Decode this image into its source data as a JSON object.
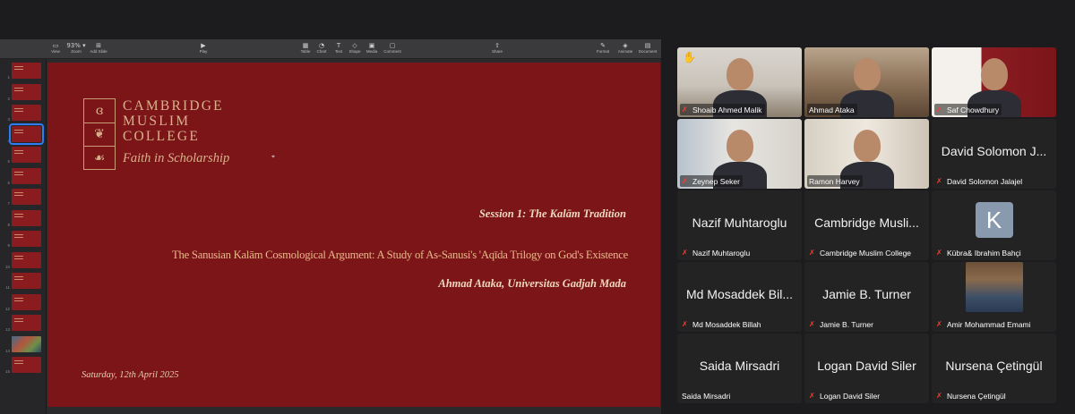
{
  "keynote": {
    "toolbar": [
      {
        "icon": "view-icon",
        "glyph": "▭",
        "label": "View"
      },
      {
        "icon": "zoom-icon",
        "glyph": "93% ▾",
        "label": "Zoom"
      },
      {
        "icon": "add-slide-icon",
        "glyph": "⊞",
        "label": "Add Slide"
      },
      {
        "icon": "play-icon",
        "glyph": "▶",
        "label": "Play"
      },
      {
        "icon": "table-icon",
        "glyph": "▦",
        "label": "Table"
      },
      {
        "icon": "chart-icon",
        "glyph": "◔",
        "label": "Chart"
      },
      {
        "icon": "text-icon",
        "glyph": "T",
        "label": "Text"
      },
      {
        "icon": "shape-icon",
        "glyph": "◇",
        "label": "Shape"
      },
      {
        "icon": "media-icon",
        "glyph": "▣",
        "label": "Media"
      },
      {
        "icon": "comment-icon",
        "glyph": "▢",
        "label": "Comment"
      },
      {
        "icon": "share-icon",
        "glyph": "⇧",
        "label": "Share"
      },
      {
        "icon": "format-icon",
        "glyph": "✎",
        "label": "Format"
      },
      {
        "icon": "animate-icon",
        "glyph": "◈",
        "label": "Animate"
      },
      {
        "icon": "document-icon",
        "glyph": "▤",
        "label": "Document"
      }
    ],
    "thumbnails": [
      "1",
      "2",
      "3",
      "4",
      "5",
      "6",
      "7",
      "8",
      "9",
      "10",
      "11",
      "12",
      "13",
      "14",
      "15"
    ],
    "selected_slide": "4",
    "slide": {
      "logo_glyphs": [
        "ɞ",
        "❦",
        "☙"
      ],
      "org_lines": [
        "CAMBRIDGE",
        "MUSLIM",
        "COLLEGE"
      ],
      "motto": "Faith in Scholarship",
      "session": "Session 1: The Kalām Tradition",
      "talk_title": "The Sanusian Kalām Cosmological Argument: A Study of As-Sanusi's 'Aqīda Trilogy on God's Existence",
      "speaker": "Ahmad Ataka, Universitas Gadjah Mada",
      "date": "Saturday, 12th April 2025"
    }
  },
  "zoom": {
    "participants": [
      {
        "name": "Shoaib Ahmed Malik",
        "video": true,
        "muted": true,
        "hand_raised": true,
        "active": false
      },
      {
        "name": "Ahmad Ataka",
        "video": true,
        "muted": false,
        "active": true
      },
      {
        "name": "Saf Chowdhury",
        "video": true,
        "muted": true,
        "active": false
      },
      {
        "name": "Zeynep Seker",
        "video": true,
        "muted": true,
        "active": false
      },
      {
        "name": "Ramon Harvey",
        "video": true,
        "muted": false,
        "active": false
      },
      {
        "name": "David Solomon Jalajel",
        "display": "David Solomon J...",
        "video": false,
        "muted": true
      },
      {
        "name": "Nazif Muhtaroglu",
        "display": "Nazif Muhtaroglu",
        "video": false,
        "muted": true
      },
      {
        "name": "Cambridge Muslim College",
        "display": "Cambridge Musli...",
        "video": false,
        "muted": true
      },
      {
        "name": "Kübra& Ibrahim Bahçi",
        "display": "K",
        "video": false,
        "muted": true,
        "avatar_letter": true
      },
      {
        "name": "Md Mosaddek Billah",
        "display": "Md Mosaddek Bil...",
        "video": false,
        "muted": true
      },
      {
        "name": "Jamie B. Turner",
        "display": "Jamie B. Turner",
        "video": false,
        "muted": true
      },
      {
        "name": "Amir Mohammad Emami",
        "video": false,
        "muted": true,
        "photo": true
      },
      {
        "name": "Saida Mirsadri",
        "display": "Saida Mirsadri",
        "video": false,
        "muted": false
      },
      {
        "name": "Logan David Siler",
        "display": "Logan David Siler",
        "video": false,
        "muted": true
      },
      {
        "name": "Nursena Çetingül",
        "display": "Nursena Çetingül",
        "video": false,
        "muted": true
      }
    ]
  }
}
